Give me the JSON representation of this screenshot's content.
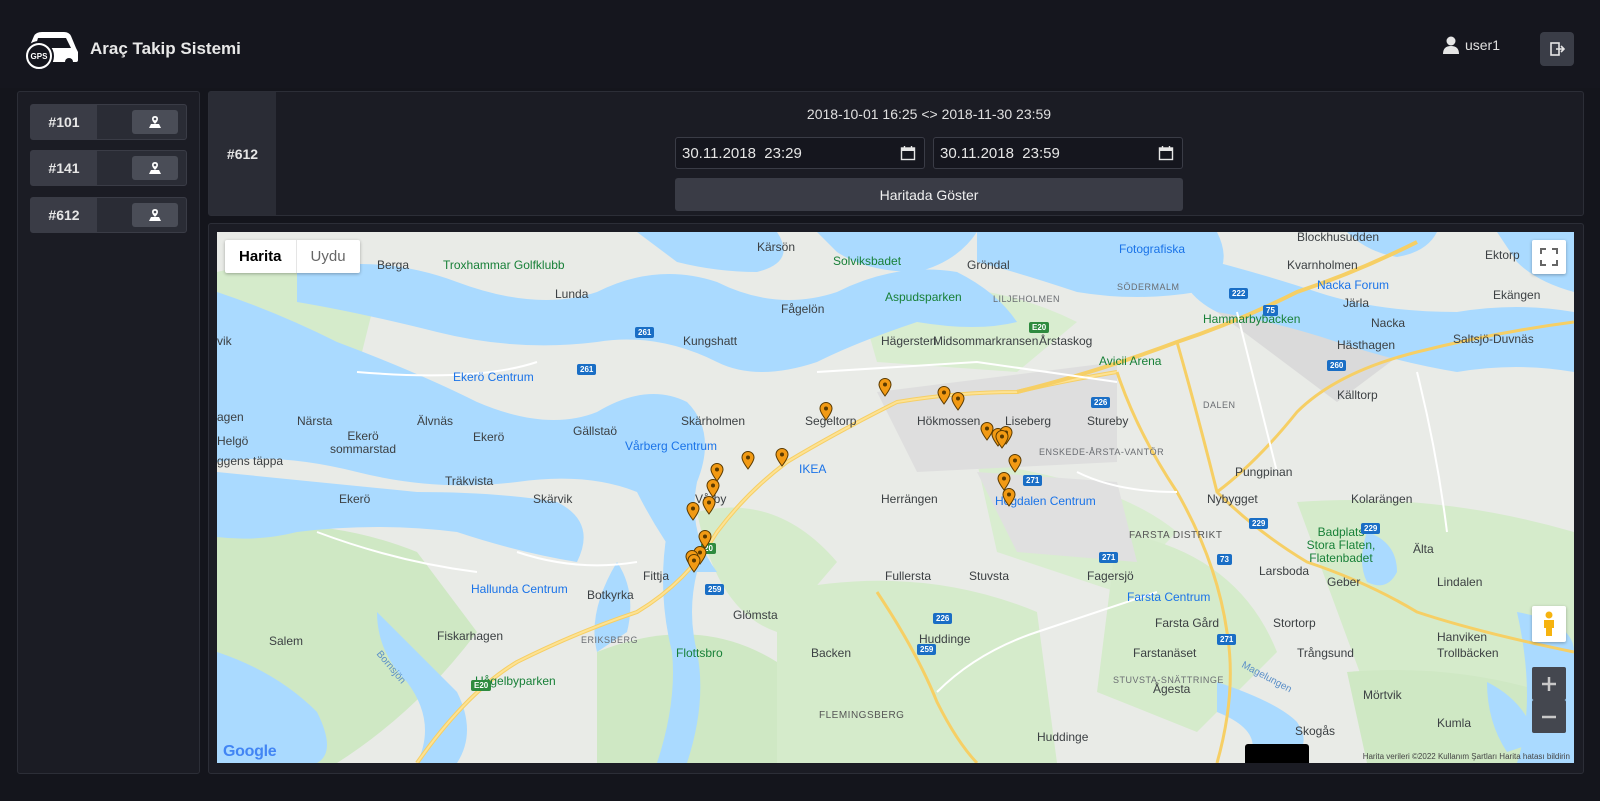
{
  "app": {
    "title": "Araç Takip Sistemi",
    "logo_text": "GPS"
  },
  "user": {
    "name": "user1"
  },
  "vehicles": [
    {
      "id": "#101"
    },
    {
      "id": "#141"
    },
    {
      "id": "#612"
    }
  ],
  "panel": {
    "selected_vehicle": "#612",
    "range_text": "2018-10-01 16:25 <> 2018-11-30 23:59",
    "start_value": "30.11.2018  23:29",
    "end_value": "30.11.2018  23:59",
    "show_button": "Haritada Göster"
  },
  "map": {
    "type_active": "Harita",
    "type_inactive": "Uydu",
    "google_logo": "Google",
    "footer": "Harita verileri ©2022  Kullanım Şartları  Harita hatası bildirin",
    "labels": [
      {
        "t": "Kärsön"
      },
      {
        "t": "Berga"
      },
      {
        "t": "Troxhammar Golfklubb"
      },
      {
        "t": "Lunda"
      },
      {
        "t": "Solviksbadet"
      },
      {
        "t": "Gröndal"
      },
      {
        "t": "Fotografiska"
      },
      {
        "t": "Blockhusudden"
      },
      {
        "t": "Ektorp"
      },
      {
        "t": "Kvarnholmen"
      },
      {
        "t": "Fågelön"
      },
      {
        "t": "Aspudsparken"
      },
      {
        "t": "LILJEHOLMEN"
      },
      {
        "t": "SÖDERMALM"
      },
      {
        "t": "Nacka Forum"
      },
      {
        "t": "Järla"
      },
      {
        "t": "Ekängen"
      },
      {
        "t": "Kungshatt"
      },
      {
        "t": "Hägersten"
      },
      {
        "t": "Midsommarkransen"
      },
      {
        "t": "Årstaskog"
      },
      {
        "t": "Hammarbybacken"
      },
      {
        "t": "Nacka"
      },
      {
        "t": "Saltsjö-Duvnäs"
      },
      {
        "t": "Hästhagen"
      },
      {
        "t": "vik"
      },
      {
        "t": "Ekerö Centrum"
      },
      {
        "t": "Avicii Arena"
      },
      {
        "t": "Källtorp"
      },
      {
        "t": "agen"
      },
      {
        "t": "Närsta"
      },
      {
        "t": "Älvnäs"
      },
      {
        "t": "Skärholmen"
      },
      {
        "t": "Segeltorp"
      },
      {
        "t": "Hökmossen"
      },
      {
        "t": "Liseberg"
      },
      {
        "t": "Stureby"
      },
      {
        "t": "DALEN"
      },
      {
        "t": "Helgö"
      },
      {
        "t": "Ekerö sommarstad"
      },
      {
        "t": "Ekerö"
      },
      {
        "t": "Gällstaö"
      },
      {
        "t": "Vårberg Centrum"
      },
      {
        "t": "IKEA"
      },
      {
        "t": "ENSKEDE-ÅRSTA-VANTÖR"
      },
      {
        "t": "ggens täppa"
      },
      {
        "t": "Träkvista"
      },
      {
        "t": "Pungpinan"
      },
      {
        "t": "Ekerö"
      },
      {
        "t": "Skärvik"
      },
      {
        "t": "Vårby"
      },
      {
        "t": "Herrängen"
      },
      {
        "t": "Högdalen Centrum"
      },
      {
        "t": "Nybygget"
      },
      {
        "t": "Kolarängen"
      },
      {
        "t": "FARSTA DISTRIKT"
      },
      {
        "t": "Badplats Stora Flaten, Flatenbadet"
      },
      {
        "t": "Älta"
      },
      {
        "t": "Fittja"
      },
      {
        "t": "Fullersta"
      },
      {
        "t": "Stuvsta"
      },
      {
        "t": "Fagersjö"
      },
      {
        "t": "Larsboda"
      },
      {
        "t": "Geber"
      },
      {
        "t": "Lindalen"
      },
      {
        "t": "Hallunda Centrum"
      },
      {
        "t": "Botkyrka"
      },
      {
        "t": "Farsta Centrum"
      },
      {
        "t": "Glömsta"
      },
      {
        "t": "Salem"
      },
      {
        "t": "Fiskarhagen"
      },
      {
        "t": "ERIKSBERG"
      },
      {
        "t": "Huddinge"
      },
      {
        "t": "Farsta Gård"
      },
      {
        "t": "Stortorp"
      },
      {
        "t": "Hanviken"
      },
      {
        "t": "Flottsbro"
      },
      {
        "t": "Backen"
      },
      {
        "t": "Farstanäset"
      },
      {
        "t": "Trångsund"
      },
      {
        "t": "Trollbäcken"
      },
      {
        "t": "Bornsjön"
      },
      {
        "t": "Hågelbyparken"
      },
      {
        "t": "STUVSTA-SNÄTTRINGE"
      },
      {
        "t": "Ågesta"
      },
      {
        "t": "Magelungen"
      },
      {
        "t": "Mörtvik"
      },
      {
        "t": "FLEMINGSBERG"
      },
      {
        "t": "Skogås"
      },
      {
        "t": "Kumla"
      },
      {
        "t": "Huddinge"
      }
    ],
    "roads": [
      "261",
      "261",
      "E20",
      "222",
      "75",
      "260",
      "226",
      "271",
      "229",
      "271",
      "73",
      "229",
      "226",
      "259",
      "259",
      "E20",
      "20",
      "271"
    ]
  }
}
